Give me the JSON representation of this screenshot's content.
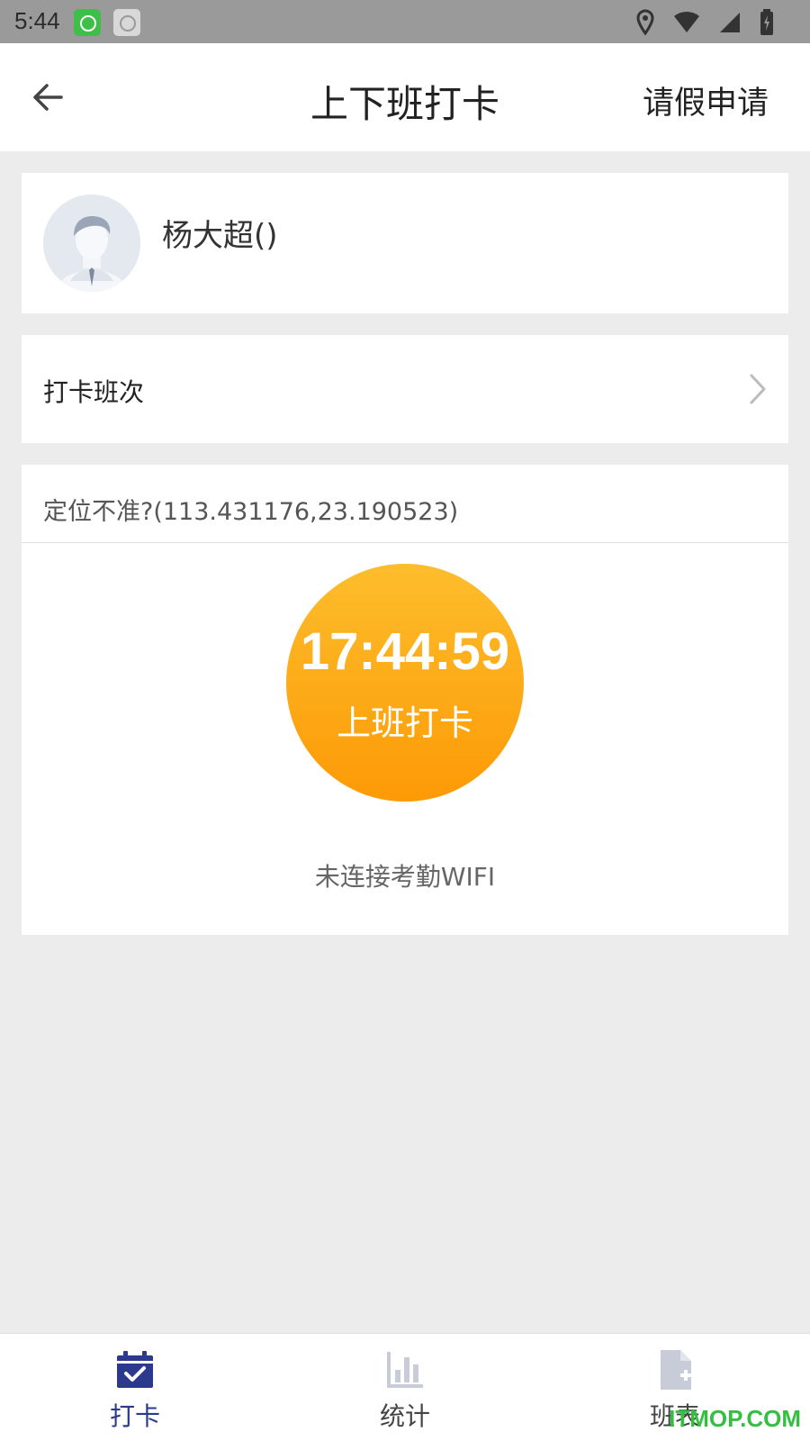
{
  "status_bar": {
    "time": "5:44"
  },
  "header": {
    "title": "上下班打卡",
    "action_label": "请假申请"
  },
  "profile": {
    "name": "杨大超()"
  },
  "shift": {
    "label": "打卡班次"
  },
  "punch": {
    "location_text": "定位不准?(113.431176,23.190523)",
    "time": "17:44:59",
    "button_label": "上班打卡",
    "wifi_status": "未连接考勤WIFI"
  },
  "tabs": [
    {
      "label": "打卡",
      "icon": "calendar-check-icon",
      "active": true
    },
    {
      "label": "统计",
      "icon": "bar-chart-icon",
      "active": false
    },
    {
      "label": "班表",
      "icon": "document-add-icon",
      "active": false
    }
  ],
  "watermark": "ITMOP.COM",
  "colors": {
    "accent": "#2b3a8c",
    "button_top": "#fdbd2c",
    "button_bottom": "#fd9a06"
  }
}
